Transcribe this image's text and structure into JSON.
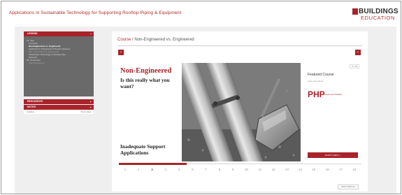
{
  "header": {
    "course_title": "Applications in Sustainable Technology for Supporting Rooftop Piping & Equipment",
    "logo_line1": "BUILDINGS",
    "logo_line2": "EDUCATION"
  },
  "sidebar": {
    "legend_label": "LEGEND",
    "legend_items": [
      {
        "text": "01. Intro",
        "kind": "normal"
      },
      {
        "text": "Overview",
        "kind": "sub"
      },
      {
        "text": "Non-Engineered vs. Engineered",
        "kind": "current"
      },
      {
        "text": "Applications of Engineered Support Systems",
        "kind": "sub"
      },
      {
        "text": "Pipe Stand Material Applications",
        "kind": "dim"
      },
      {
        "text": "Sustainable Technology in Rooftop Pipe",
        "kind": "sub"
      },
      {
        "text": "Supports",
        "kind": "sub"
      },
      {
        "text": "02. Conclusion",
        "kind": "normal"
      },
      {
        "text": "Self-Assessment",
        "kind": "dim"
      }
    ],
    "resources_label": "RESOURCES",
    "notes_label": "NOTES",
    "footer_left": "Updates",
    "footer_right": "Show Help"
  },
  "main": {
    "breadcrumb_course": "Course",
    "breadcrumb_sep": " / ",
    "breadcrumb_page": "Non-Engineered vs. Engineered",
    "prev_icon": "‹",
    "next_icon": "›",
    "expand_label": "Slide Fullscreen"
  },
  "slide": {
    "title": "Non-Engineered",
    "question": "Is this really what you want?",
    "subtitle": "Inadequate Support Applications",
    "page_indicator": "5 / 18"
  },
  "featured": {
    "title": "Featured Course",
    "subtitle": "Learn more about",
    "brand": "PHP",
    "brand_sub": "Systems and Solutions",
    "button_label": "WHAT'S NEXT »"
  },
  "pagination": {
    "pages": [
      "1",
      "2",
      "3",
      "4",
      "5",
      "6",
      "7",
      "8",
      "9",
      "10",
      "11",
      "12",
      "13",
      "14",
      "15",
      "16",
      "17",
      "18"
    ],
    "current": 3,
    "progress": 0.28
  },
  "colors": {
    "accent": "#a8232a",
    "sidebar_bg": "#6a6a6a",
    "workspace": "#efefef"
  }
}
